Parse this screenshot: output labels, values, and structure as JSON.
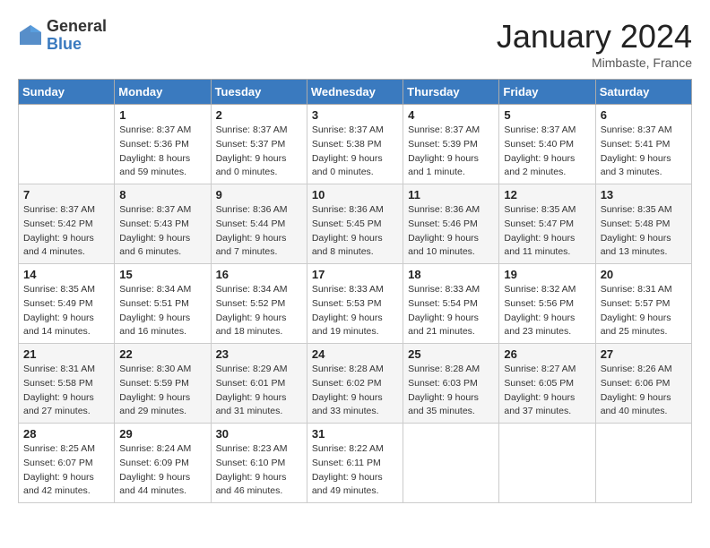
{
  "header": {
    "logo_general": "General",
    "logo_blue": "Blue",
    "title": "January 2024",
    "location": "Mimbaste, France"
  },
  "days_of_week": [
    "Sunday",
    "Monday",
    "Tuesday",
    "Wednesday",
    "Thursday",
    "Friday",
    "Saturday"
  ],
  "weeks": [
    [
      {
        "day": "",
        "sunrise": "",
        "sunset": "",
        "daylight": ""
      },
      {
        "day": "1",
        "sunrise": "Sunrise: 8:37 AM",
        "sunset": "Sunset: 5:36 PM",
        "daylight": "Daylight: 8 hours and 59 minutes."
      },
      {
        "day": "2",
        "sunrise": "Sunrise: 8:37 AM",
        "sunset": "Sunset: 5:37 PM",
        "daylight": "Daylight: 9 hours and 0 minutes."
      },
      {
        "day": "3",
        "sunrise": "Sunrise: 8:37 AM",
        "sunset": "Sunset: 5:38 PM",
        "daylight": "Daylight: 9 hours and 0 minutes."
      },
      {
        "day": "4",
        "sunrise": "Sunrise: 8:37 AM",
        "sunset": "Sunset: 5:39 PM",
        "daylight": "Daylight: 9 hours and 1 minute."
      },
      {
        "day": "5",
        "sunrise": "Sunrise: 8:37 AM",
        "sunset": "Sunset: 5:40 PM",
        "daylight": "Daylight: 9 hours and 2 minutes."
      },
      {
        "day": "6",
        "sunrise": "Sunrise: 8:37 AM",
        "sunset": "Sunset: 5:41 PM",
        "daylight": "Daylight: 9 hours and 3 minutes."
      }
    ],
    [
      {
        "day": "7",
        "sunrise": "Sunrise: 8:37 AM",
        "sunset": "Sunset: 5:42 PM",
        "daylight": "Daylight: 9 hours and 4 minutes."
      },
      {
        "day": "8",
        "sunrise": "Sunrise: 8:37 AM",
        "sunset": "Sunset: 5:43 PM",
        "daylight": "Daylight: 9 hours and 6 minutes."
      },
      {
        "day": "9",
        "sunrise": "Sunrise: 8:36 AM",
        "sunset": "Sunset: 5:44 PM",
        "daylight": "Daylight: 9 hours and 7 minutes."
      },
      {
        "day": "10",
        "sunrise": "Sunrise: 8:36 AM",
        "sunset": "Sunset: 5:45 PM",
        "daylight": "Daylight: 9 hours and 8 minutes."
      },
      {
        "day": "11",
        "sunrise": "Sunrise: 8:36 AM",
        "sunset": "Sunset: 5:46 PM",
        "daylight": "Daylight: 9 hours and 10 minutes."
      },
      {
        "day": "12",
        "sunrise": "Sunrise: 8:35 AM",
        "sunset": "Sunset: 5:47 PM",
        "daylight": "Daylight: 9 hours and 11 minutes."
      },
      {
        "day": "13",
        "sunrise": "Sunrise: 8:35 AM",
        "sunset": "Sunset: 5:48 PM",
        "daylight": "Daylight: 9 hours and 13 minutes."
      }
    ],
    [
      {
        "day": "14",
        "sunrise": "Sunrise: 8:35 AM",
        "sunset": "Sunset: 5:49 PM",
        "daylight": "Daylight: 9 hours and 14 minutes."
      },
      {
        "day": "15",
        "sunrise": "Sunrise: 8:34 AM",
        "sunset": "Sunset: 5:51 PM",
        "daylight": "Daylight: 9 hours and 16 minutes."
      },
      {
        "day": "16",
        "sunrise": "Sunrise: 8:34 AM",
        "sunset": "Sunset: 5:52 PM",
        "daylight": "Daylight: 9 hours and 18 minutes."
      },
      {
        "day": "17",
        "sunrise": "Sunrise: 8:33 AM",
        "sunset": "Sunset: 5:53 PM",
        "daylight": "Daylight: 9 hours and 19 minutes."
      },
      {
        "day": "18",
        "sunrise": "Sunrise: 8:33 AM",
        "sunset": "Sunset: 5:54 PM",
        "daylight": "Daylight: 9 hours and 21 minutes."
      },
      {
        "day": "19",
        "sunrise": "Sunrise: 8:32 AM",
        "sunset": "Sunset: 5:56 PM",
        "daylight": "Daylight: 9 hours and 23 minutes."
      },
      {
        "day": "20",
        "sunrise": "Sunrise: 8:31 AM",
        "sunset": "Sunset: 5:57 PM",
        "daylight": "Daylight: 9 hours and 25 minutes."
      }
    ],
    [
      {
        "day": "21",
        "sunrise": "Sunrise: 8:31 AM",
        "sunset": "Sunset: 5:58 PM",
        "daylight": "Daylight: 9 hours and 27 minutes."
      },
      {
        "day": "22",
        "sunrise": "Sunrise: 8:30 AM",
        "sunset": "Sunset: 5:59 PM",
        "daylight": "Daylight: 9 hours and 29 minutes."
      },
      {
        "day": "23",
        "sunrise": "Sunrise: 8:29 AM",
        "sunset": "Sunset: 6:01 PM",
        "daylight": "Daylight: 9 hours and 31 minutes."
      },
      {
        "day": "24",
        "sunrise": "Sunrise: 8:28 AM",
        "sunset": "Sunset: 6:02 PM",
        "daylight": "Daylight: 9 hours and 33 minutes."
      },
      {
        "day": "25",
        "sunrise": "Sunrise: 8:28 AM",
        "sunset": "Sunset: 6:03 PM",
        "daylight": "Daylight: 9 hours and 35 minutes."
      },
      {
        "day": "26",
        "sunrise": "Sunrise: 8:27 AM",
        "sunset": "Sunset: 6:05 PM",
        "daylight": "Daylight: 9 hours and 37 minutes."
      },
      {
        "day": "27",
        "sunrise": "Sunrise: 8:26 AM",
        "sunset": "Sunset: 6:06 PM",
        "daylight": "Daylight: 9 hours and 40 minutes."
      }
    ],
    [
      {
        "day": "28",
        "sunrise": "Sunrise: 8:25 AM",
        "sunset": "Sunset: 6:07 PM",
        "daylight": "Daylight: 9 hours and 42 minutes."
      },
      {
        "day": "29",
        "sunrise": "Sunrise: 8:24 AM",
        "sunset": "Sunset: 6:09 PM",
        "daylight": "Daylight: 9 hours and 44 minutes."
      },
      {
        "day": "30",
        "sunrise": "Sunrise: 8:23 AM",
        "sunset": "Sunset: 6:10 PM",
        "daylight": "Daylight: 9 hours and 46 minutes."
      },
      {
        "day": "31",
        "sunrise": "Sunrise: 8:22 AM",
        "sunset": "Sunset: 6:11 PM",
        "daylight": "Daylight: 9 hours and 49 minutes."
      },
      {
        "day": "",
        "sunrise": "",
        "sunset": "",
        "daylight": ""
      },
      {
        "day": "",
        "sunrise": "",
        "sunset": "",
        "daylight": ""
      },
      {
        "day": "",
        "sunrise": "",
        "sunset": "",
        "daylight": ""
      }
    ]
  ]
}
